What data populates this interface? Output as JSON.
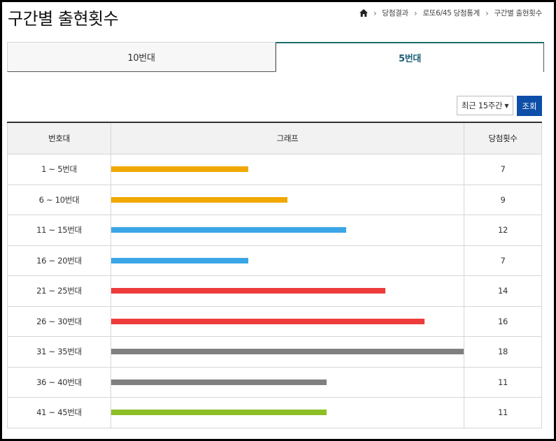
{
  "page": {
    "title": "구간별 출현횟수"
  },
  "breadcrumb": {
    "items": [
      "당첨결과",
      "로또6/45 당첨통계",
      "구간별 출현횟수"
    ]
  },
  "tabs": [
    {
      "label": "10번대",
      "active": false
    },
    {
      "label": "5번대",
      "active": true
    }
  ],
  "controls": {
    "period_label": "최근 15주간",
    "search_label": "조회"
  },
  "table": {
    "headers": [
      "번호대",
      "그래프",
      "당첨횟수"
    ],
    "scale_max": 18
  },
  "chart_data": {
    "type": "bar",
    "categories": [
      "1 ~ 5번대",
      "6 ~ 10번대",
      "11 ~ 15번대",
      "16 ~ 20번대",
      "21 ~ 25번대",
      "26 ~ 30번대",
      "31 ~ 35번대",
      "36 ~ 40번대",
      "41 ~ 45번대"
    ],
    "values": [
      7,
      9,
      12,
      7,
      14,
      16,
      18,
      11,
      11
    ],
    "colors": [
      "#f0a800",
      "#f0a800",
      "#3ba6e6",
      "#3ba6e6",
      "#ee3b3b",
      "#ee3b3b",
      "#808080",
      "#808080",
      "#8ebf26"
    ]
  },
  "icons": {
    "home": "home-icon",
    "separator": "chevron-right-icon",
    "dropdown": "caret-down-icon"
  }
}
